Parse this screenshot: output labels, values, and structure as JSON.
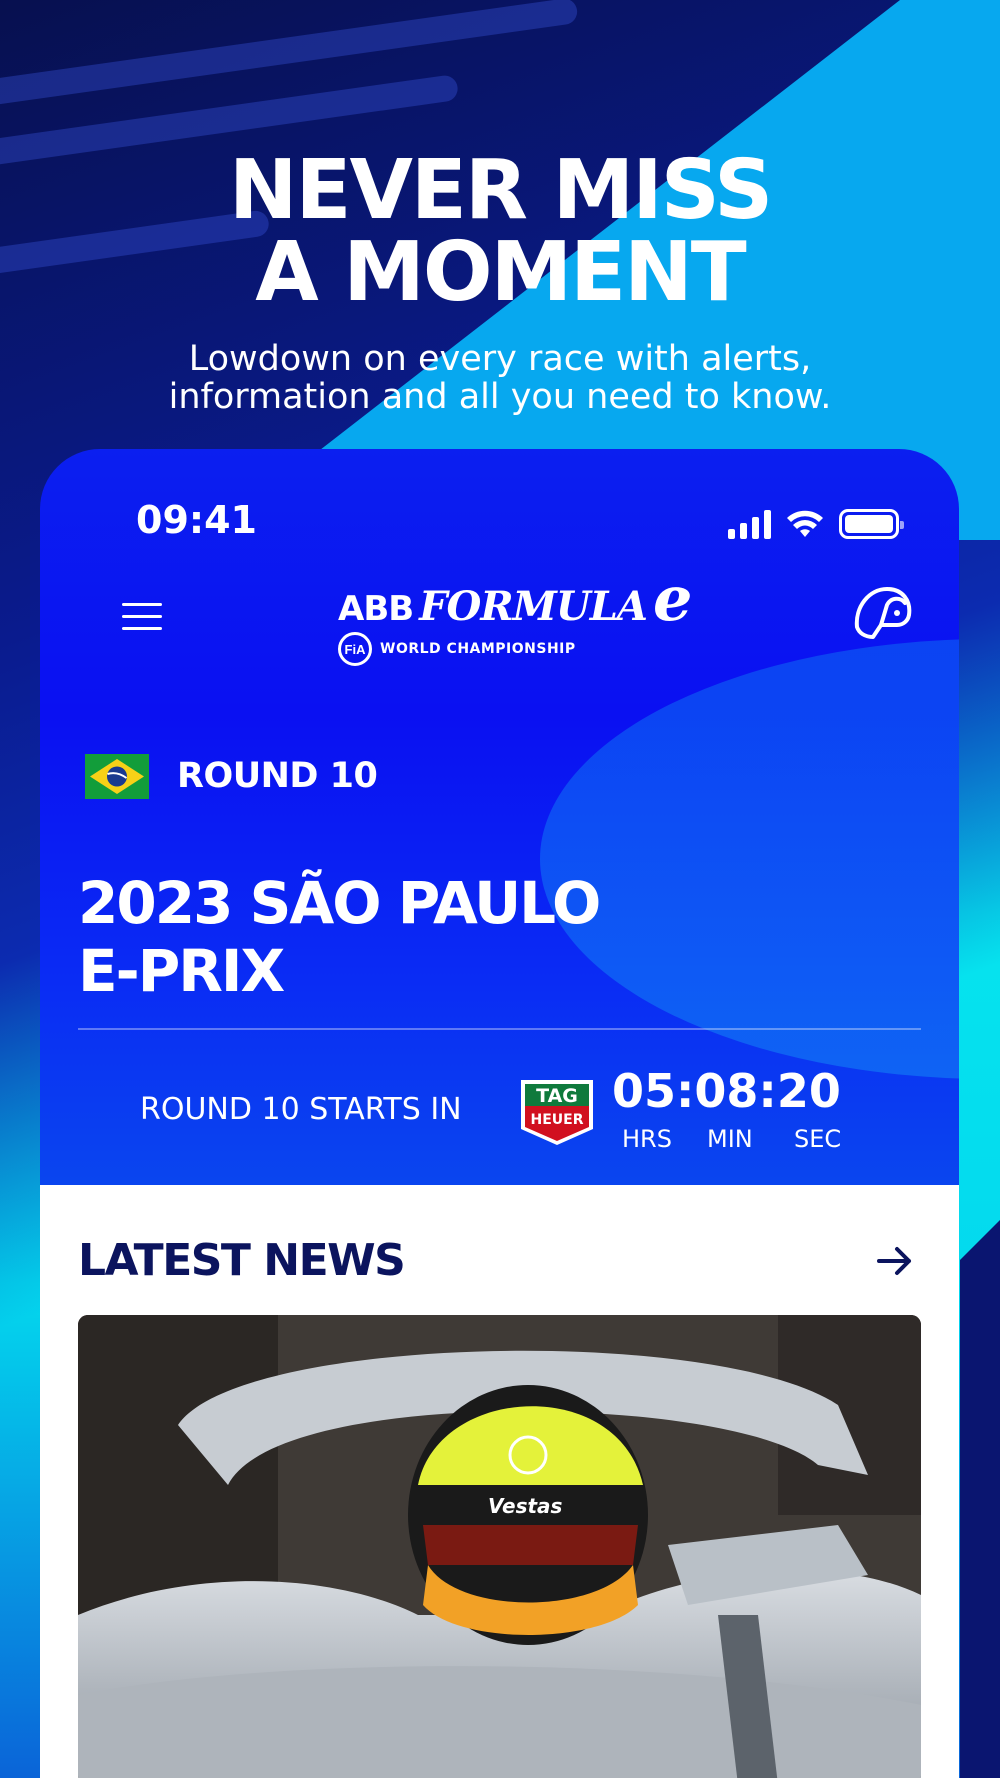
{
  "promo": {
    "headline_line1": "NEVER MISS",
    "headline_line2": "A MOMENT",
    "subline_line1": "Lowdown on every race with alerts,",
    "subline_line2": "information and all you need to know."
  },
  "status_bar": {
    "time": "09:41"
  },
  "header": {
    "menu_icon": "hamburger-menu-icon",
    "logo_abb": "ABB",
    "logo_formula": "FORMULA",
    "logo_e": "e",
    "logo_fia": "FiA",
    "logo_subtitle": "WORLD CHAMPIONSHIP",
    "profile_icon": "helmet-icon"
  },
  "race": {
    "flag": "brazil-flag",
    "round": "ROUND 10",
    "title_line1": "2023 SÃO PAULO",
    "title_line2": "E-PRIX"
  },
  "countdown": {
    "label": "ROUND 10 STARTS IN",
    "sponsor_line1": "TAG",
    "sponsor_line2": "HEUER",
    "time": "05:08:20",
    "unit_hrs": "HRS",
    "unit_min": "MIN",
    "unit_sec": "SEC"
  },
  "news": {
    "title": "LATEST NEWS",
    "arrow_icon": "arrow-right-icon",
    "helmet_text": "Vestas"
  },
  "colors": {
    "accent_blue": "#0a10f2",
    "navy_text": "#0b145e",
    "cyan": "#05e0ee"
  }
}
